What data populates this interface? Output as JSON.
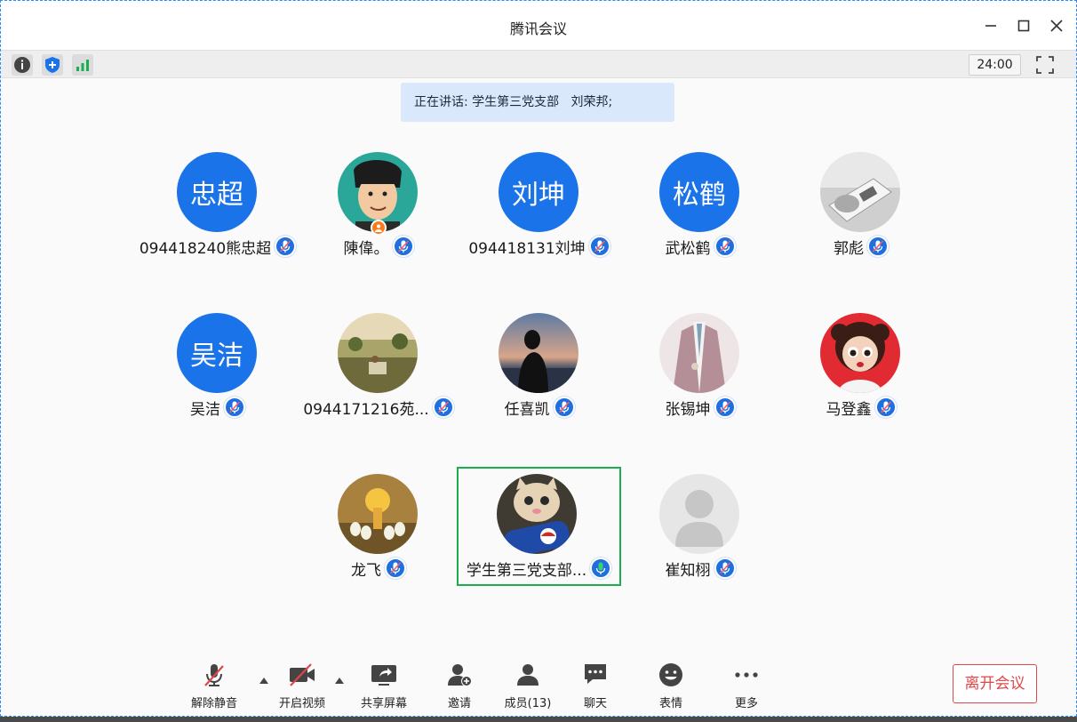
{
  "window": {
    "title": "腾讯会议"
  },
  "toolbar": {
    "timer": "24:00"
  },
  "speaking": {
    "text": "正在讲话: 学生第三党支部   刘荣邦;"
  },
  "participants": [
    {
      "name": "094418240熊忠超",
      "avatar_text": "忠超",
      "avatar_type": "text"
    },
    {
      "name": "陳偉。",
      "avatar_type": "photo",
      "photo": "cartoon-man"
    },
    {
      "name": "094418131刘坤",
      "avatar_text": "刘坤",
      "avatar_type": "text"
    },
    {
      "name": "武松鹤",
      "avatar_text": "松鹤",
      "avatar_type": "text"
    },
    {
      "name": "郭彪",
      "avatar_type": "photo",
      "photo": "hand-box"
    },
    {
      "name": "吴洁",
      "avatar_text": "吴洁",
      "avatar_type": "text"
    },
    {
      "name": "0944171216苑...",
      "avatar_type": "photo",
      "photo": "landscape"
    },
    {
      "name": "任喜凯",
      "avatar_type": "photo",
      "photo": "sunset-silhouette"
    },
    {
      "name": "张锡坤",
      "avatar_type": "photo",
      "photo": "suit-person"
    },
    {
      "name": "马登鑫",
      "avatar_type": "photo",
      "photo": "cartoon-girl"
    },
    {
      "name": "龙飞",
      "avatar_type": "photo",
      "photo": "ducks"
    },
    {
      "name": "学生第三党支部...",
      "avatar_type": "photo",
      "photo": "cat-pepsi",
      "active": true
    },
    {
      "name": "崔知栩",
      "avatar_type": "photo",
      "photo": "default-person"
    }
  ],
  "bottombar": {
    "unmute": "解除静音",
    "start_video": "开启视频",
    "share_screen": "共享屏幕",
    "invite": "邀请",
    "members": "成员(13)",
    "chat": "聊天",
    "reactions": "表情",
    "more": "更多",
    "leave": "离开会议"
  },
  "colors": {
    "accent": "#1a73e8",
    "active_border": "#1aad52",
    "leave": "#e0464b",
    "speaking_bg": "#d9e9fb"
  }
}
